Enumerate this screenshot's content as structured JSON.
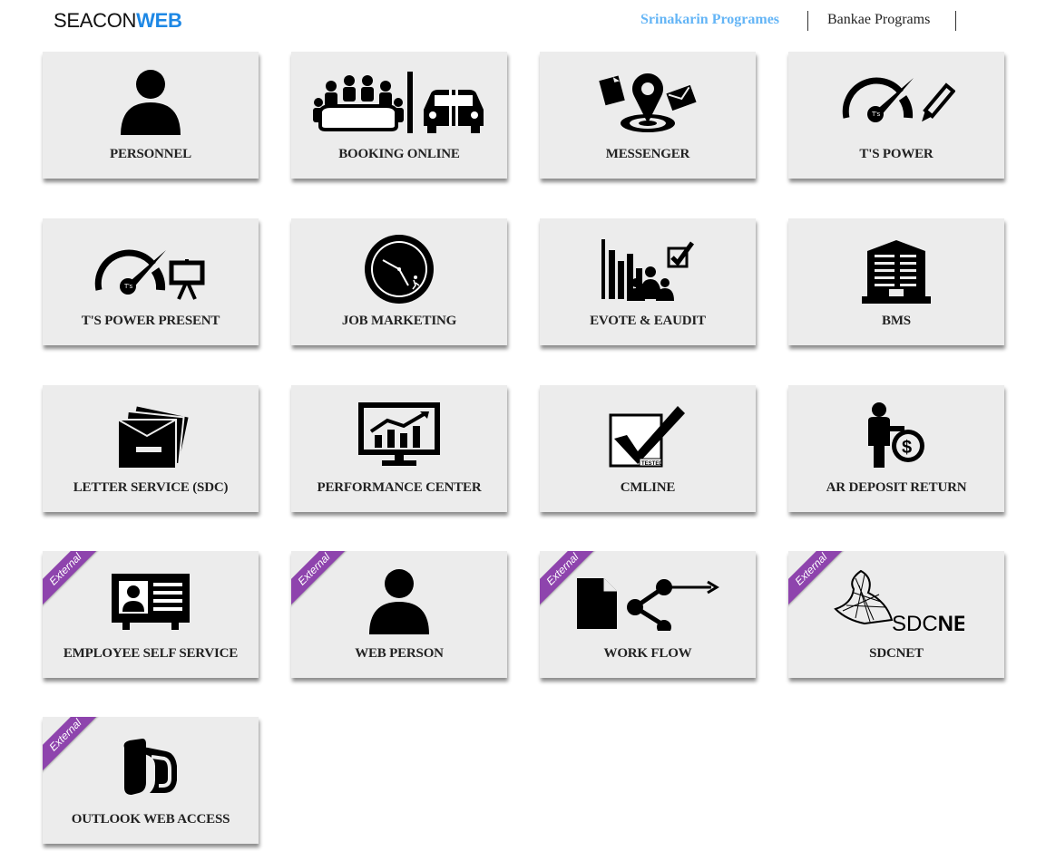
{
  "brand": {
    "part1": "SEACON",
    "part2": "WEB",
    "accent_color": "#1e88e5"
  },
  "nav": {
    "items": [
      {
        "label": "Srinakarin Programes",
        "active": true
      },
      {
        "label": "Bankae Programs",
        "active": false
      }
    ]
  },
  "badge_text": "External",
  "tiles": [
    {
      "label": "PERSONNEL",
      "icon": "person-icon",
      "external": false
    },
    {
      "label": "BOOKING ONLINE",
      "icon": "meeting-car-icon",
      "external": false
    },
    {
      "label": "MESSENGER",
      "icon": "map-pin-icon",
      "external": false
    },
    {
      "label": "T'S POWER",
      "icon": "speedometer-pencil-icon",
      "external": false
    },
    {
      "label": "T'S POWER PRESENT",
      "icon": "speedometer-presentation-icon",
      "external": false
    },
    {
      "label": "JOB MARKETING",
      "icon": "clock-icon",
      "external": false
    },
    {
      "label": "EVOTE & EAUDIT",
      "icon": "vote-chart-icon",
      "external": false
    },
    {
      "label": "BMS",
      "icon": "building-icon",
      "external": false
    },
    {
      "label": "LETTER SERVICE (SDC)",
      "icon": "letters-icon",
      "external": false
    },
    {
      "label": "PERFORMANCE CENTER",
      "icon": "monitor-chart-icon",
      "external": false
    },
    {
      "label": "CMLINE",
      "icon": "checkmark-tested-icon",
      "external": false
    },
    {
      "label": "AR DEPOSIT RETURN",
      "icon": "person-dollar-icon",
      "external": false
    },
    {
      "label": "EMPLOYEE SELF SERVICE",
      "icon": "id-card-icon",
      "external": true
    },
    {
      "label": "WEB PERSON",
      "icon": "person-icon",
      "external": true
    },
    {
      "label": "WORK FLOW",
      "icon": "document-share-icon",
      "external": true
    },
    {
      "label": "SDCNET",
      "icon": "sdcnet-logo-icon",
      "external": true,
      "logo_text_1": "SDC",
      "logo_text_2": "NET"
    },
    {
      "label": "OUTLOOK WEB ACCESS",
      "icon": "outlook-icon",
      "external": true
    }
  ],
  "colors": {
    "tile_bg": "#ececec",
    "ribbon": "#8e44ad",
    "nav_active": "#64b5f6"
  }
}
